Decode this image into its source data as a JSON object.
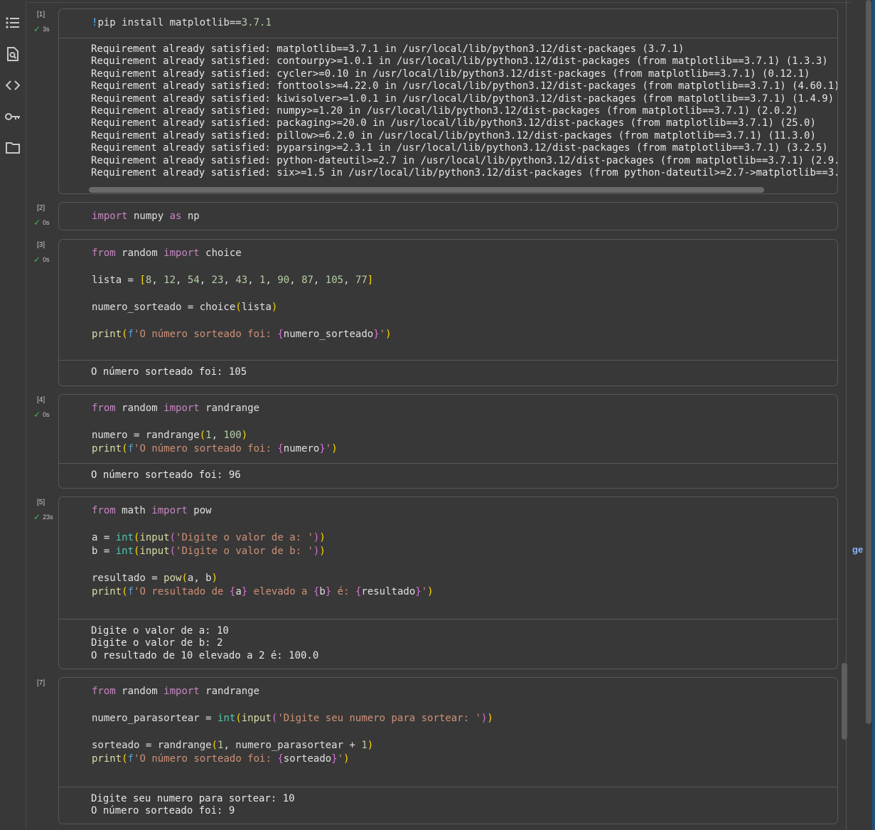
{
  "sidebar": {
    "icons": [
      "table-of-contents-icon",
      "find-replace-icon",
      "code-snippets-icon",
      "secrets-key-icon",
      "files-folder-icon"
    ]
  },
  "right_panel_text": "ge",
  "cells": [
    {
      "number": "[1]",
      "time": "3s",
      "status": "success",
      "code": [
        [
          [
            "sh",
            "!"
          ],
          [
            "pl",
            "pip install matplotlib=="
          ],
          [
            "num",
            "3.7.1"
          ]
        ]
      ],
      "output": [
        "Requirement already satisfied: matplotlib==3.7.1 in /usr/local/lib/python3.12/dist-packages (3.7.1)",
        "Requirement already satisfied: contourpy>=1.0.1 in /usr/local/lib/python3.12/dist-packages (from matplotlib==3.7.1) (1.3.3)",
        "Requirement already satisfied: cycler>=0.10 in /usr/local/lib/python3.12/dist-packages (from matplotlib==3.7.1) (0.12.1)",
        "Requirement already satisfied: fonttools>=4.22.0 in /usr/local/lib/python3.12/dist-packages (from matplotlib==3.7.1) (4.60.1)",
        "Requirement already satisfied: kiwisolver>=1.0.1 in /usr/local/lib/python3.12/dist-packages (from matplotlib==3.7.1) (1.4.9)",
        "Requirement already satisfied: numpy>=1.20 in /usr/local/lib/python3.12/dist-packages (from matplotlib==3.7.1) (2.0.2)",
        "Requirement already satisfied: packaging>=20.0 in /usr/local/lib/python3.12/dist-packages (from matplotlib==3.7.1) (25.0)",
        "Requirement already satisfied: pillow>=6.2.0 in /usr/local/lib/python3.12/dist-packages (from matplotlib==3.7.1) (11.3.0)",
        "Requirement already satisfied: pyparsing>=2.3.1 in /usr/local/lib/python3.12/dist-packages (from matplotlib==3.7.1) (3.2.5)",
        "Requirement already satisfied: python-dateutil>=2.7 in /usr/local/lib/python3.12/dist-packages (from matplotlib==3.7.1) (2.9.",
        "Requirement already satisfied: six>=1.5 in /usr/local/lib/python3.12/dist-packages (from python-dateutil>=2.7->matplotlib==3."
      ]
    },
    {
      "number": "[2]",
      "time": "0s",
      "status": "success",
      "code": [
        [
          [
            "kw",
            "import"
          ],
          [
            "pl",
            " numpy "
          ],
          [
            "kw",
            "as"
          ],
          [
            "pl",
            " np"
          ]
        ]
      ],
      "output": []
    },
    {
      "number": "[3]",
      "time": "0s",
      "status": "success",
      "code": [
        [
          [
            "kw",
            "from"
          ],
          [
            "pl",
            " random "
          ],
          [
            "kw",
            "import"
          ],
          [
            "pl",
            " choice"
          ]
        ],
        [],
        [
          [
            "pl",
            "lista = "
          ],
          [
            "br",
            "["
          ],
          [
            "num",
            "8"
          ],
          [
            "pl",
            ", "
          ],
          [
            "num",
            "12"
          ],
          [
            "pl",
            ", "
          ],
          [
            "num",
            "54"
          ],
          [
            "pl",
            ", "
          ],
          [
            "num",
            "23"
          ],
          [
            "pl",
            ", "
          ],
          [
            "num",
            "43"
          ],
          [
            "pl",
            ", "
          ],
          [
            "num",
            "1"
          ],
          [
            "pl",
            ", "
          ],
          [
            "num",
            "90"
          ],
          [
            "pl",
            ", "
          ],
          [
            "num",
            "87"
          ],
          [
            "pl",
            ", "
          ],
          [
            "num",
            "105"
          ],
          [
            "pl",
            ", "
          ],
          [
            "num",
            "77"
          ],
          [
            "br",
            "]"
          ]
        ],
        [],
        [
          [
            "pl",
            "numero_sorteado = choice"
          ],
          [
            "br",
            "("
          ],
          [
            "pl",
            "lista"
          ],
          [
            "br",
            ")"
          ]
        ],
        [],
        [
          [
            "fn",
            "print"
          ],
          [
            "br",
            "("
          ],
          [
            "fp",
            "f"
          ],
          [
            "str",
            "'O número sorteado foi: "
          ],
          [
            "brc",
            "{"
          ],
          [
            "pl",
            "numero_sorteado"
          ],
          [
            "brc",
            "}"
          ],
          [
            "str",
            "'"
          ],
          [
            "br",
            ")"
          ]
        ],
        []
      ],
      "output": [
        "O número sorteado foi: 105"
      ]
    },
    {
      "number": "[4]",
      "time": "0s",
      "status": "success",
      "code": [
        [
          [
            "kw",
            "from"
          ],
          [
            "pl",
            " random "
          ],
          [
            "kw",
            "import"
          ],
          [
            "pl",
            " randrange"
          ]
        ],
        [],
        [
          [
            "pl",
            "numero = randrange"
          ],
          [
            "br",
            "("
          ],
          [
            "num",
            "1"
          ],
          [
            "pl",
            ", "
          ],
          [
            "num",
            "100"
          ],
          [
            "br",
            ")"
          ]
        ],
        [
          [
            "fn",
            "print"
          ],
          [
            "br",
            "("
          ],
          [
            "fp",
            "f"
          ],
          [
            "str",
            "'O número sorteado foi: "
          ],
          [
            "brc",
            "{"
          ],
          [
            "pl",
            "numero"
          ],
          [
            "brc",
            "}"
          ],
          [
            "str",
            "'"
          ],
          [
            "br",
            ")"
          ]
        ]
      ],
      "output": [
        "O número sorteado foi: 96"
      ]
    },
    {
      "number": "[5]",
      "time": "23s",
      "status": "success",
      "code": [
        [
          [
            "kw",
            "from"
          ],
          [
            "pl",
            " math "
          ],
          [
            "kw",
            "import"
          ],
          [
            "pl",
            " pow"
          ]
        ],
        [],
        [
          [
            "pl",
            "a = "
          ],
          [
            "ty",
            "int"
          ],
          [
            "br",
            "("
          ],
          [
            "fn",
            "input"
          ],
          [
            "brc",
            "("
          ],
          [
            "str",
            "'Digite o valor de a: '"
          ],
          [
            "brc",
            ")"
          ],
          [
            "br",
            ")"
          ]
        ],
        [
          [
            "pl",
            "b = "
          ],
          [
            "ty",
            "int"
          ],
          [
            "br",
            "("
          ],
          [
            "fn",
            "input"
          ],
          [
            "brc",
            "("
          ],
          [
            "str",
            "'Digite o valor de b: '"
          ],
          [
            "brc",
            ")"
          ],
          [
            "br",
            ")"
          ]
        ],
        [],
        [
          [
            "pl",
            "resultado = "
          ],
          [
            "fn",
            "pow"
          ],
          [
            "br",
            "("
          ],
          [
            "pl",
            "a, b"
          ],
          [
            "br",
            ")"
          ]
        ],
        [
          [
            "fn",
            "print"
          ],
          [
            "br",
            "("
          ],
          [
            "fp",
            "f"
          ],
          [
            "str",
            "'O resultado de "
          ],
          [
            "brc",
            "{"
          ],
          [
            "pl",
            "a"
          ],
          [
            "brc",
            "}"
          ],
          [
            "str",
            " elevado a "
          ],
          [
            "brc",
            "{"
          ],
          [
            "pl",
            "b"
          ],
          [
            "brc",
            "}"
          ],
          [
            "str",
            " é: "
          ],
          [
            "brc",
            "{"
          ],
          [
            "pl",
            "resultado"
          ],
          [
            "brc",
            "}"
          ],
          [
            "str",
            "'"
          ],
          [
            "br",
            ")"
          ]
        ],
        []
      ],
      "output": [
        "Digite o valor de a: 10",
        "Digite o valor de b: 2",
        "O resultado de 10 elevado a 2 é: 100.0"
      ]
    },
    {
      "number": "[7]",
      "time": "",
      "status": "",
      "code": [
        [
          [
            "kw",
            "from"
          ],
          [
            "pl",
            " random "
          ],
          [
            "kw",
            "import"
          ],
          [
            "pl",
            " randrange"
          ]
        ],
        [],
        [
          [
            "pl",
            "numero_parasortear = "
          ],
          [
            "ty",
            "int"
          ],
          [
            "br",
            "("
          ],
          [
            "fn",
            "input"
          ],
          [
            "brc",
            "("
          ],
          [
            "str",
            "'Digite seu numero para sortear: '"
          ],
          [
            "brc",
            ")"
          ],
          [
            "br",
            ")"
          ]
        ],
        [],
        [
          [
            "pl",
            "sorteado = randrange"
          ],
          [
            "br",
            "("
          ],
          [
            "num",
            "1"
          ],
          [
            "pl",
            ", numero_parasortear + "
          ],
          [
            "num",
            "1"
          ],
          [
            "br",
            ")"
          ]
        ],
        [
          [
            "fn",
            "print"
          ],
          [
            "br",
            "("
          ],
          [
            "fp",
            "f"
          ],
          [
            "str",
            "'O número sorteado foi: "
          ],
          [
            "brc",
            "{"
          ],
          [
            "pl",
            "sorteado"
          ],
          [
            "brc",
            "}"
          ],
          [
            "str",
            "'"
          ],
          [
            "br",
            ")"
          ]
        ],
        []
      ],
      "output": [
        "Digite seu numero para sortear: 10",
        "O número sorteado foi: 9"
      ]
    }
  ]
}
